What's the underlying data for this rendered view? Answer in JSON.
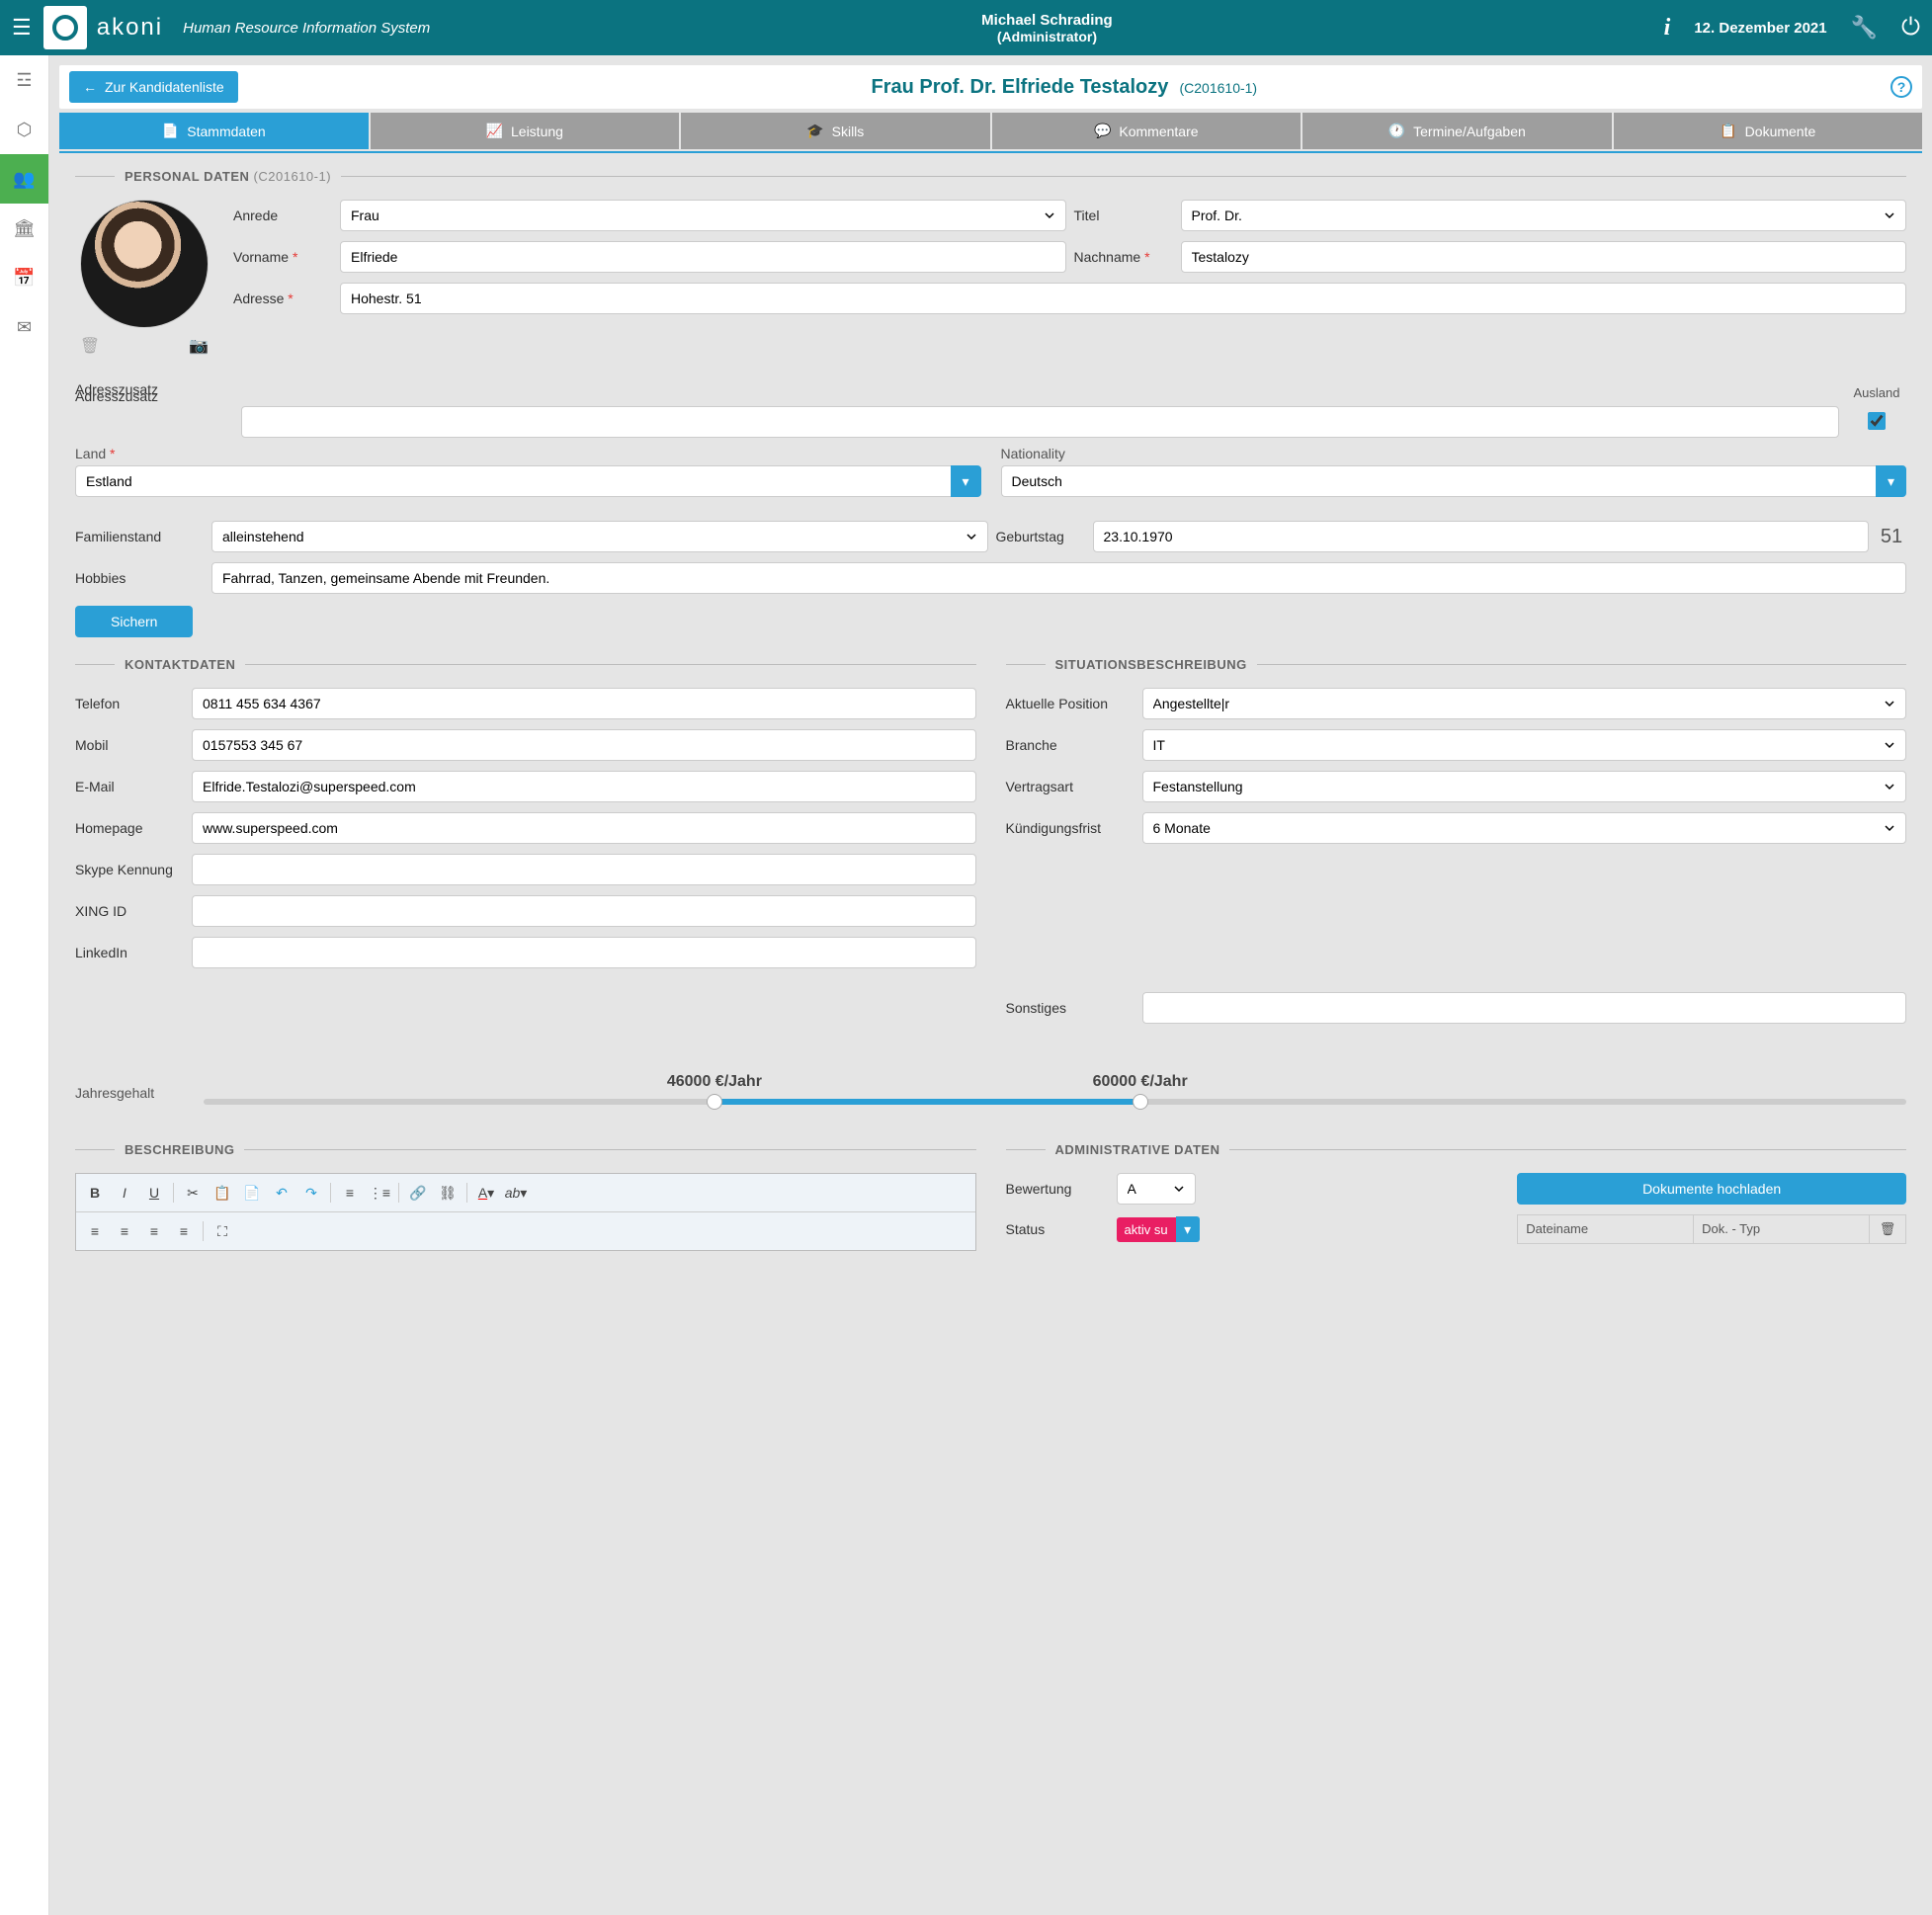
{
  "header": {
    "brand": "akoni",
    "tagline": "Human Resource Information System",
    "user": "Michael Schrading",
    "role": "(Administrator)",
    "date": "12. Dezember 2021"
  },
  "page": {
    "back": "Zur Kandidatenliste",
    "title": "Frau Prof. Dr. Elfriede Testalozy",
    "pid": "(C201610-1)"
  },
  "tabs": [
    "Stammdaten",
    "Leistung",
    "Skills",
    "Kommentare",
    "Termine/Aufgaben",
    "Dokumente"
  ],
  "sections": {
    "personal": {
      "title": "PERSONAL DATEN",
      "sub": "(C201610-1)"
    },
    "contact": "KONTAKTDATEN",
    "situation": "SITUATIONSBESCHREIBUNG",
    "description": "BESCHREIBUNG",
    "admin": "ADMINISTRATIVE DATEN"
  },
  "labels": {
    "anrede": "Anrede",
    "titel": "Titel",
    "vorname": "Vorname",
    "nachname": "Nachname",
    "adresse": "Adresse",
    "adresszusatz": "Adresszusatz",
    "ausland": "Ausland",
    "land": "Land",
    "nationality": "Nationality",
    "familienstand": "Familienstand",
    "geburtstag": "Geburtstag",
    "hobbies": "Hobbies",
    "sichern": "Sichern",
    "telefon": "Telefon",
    "mobil": "Mobil",
    "email": "E-Mail",
    "homepage": "Homepage",
    "skype": "Skype Kennung",
    "xing": "XING ID",
    "linkedin": "LinkedIn",
    "sonstiges": "Sonstiges",
    "position": "Aktuelle Position",
    "branche": "Branche",
    "vertragsart": "Vertragsart",
    "kuendigung": "Kündigungsfrist",
    "jahresgehalt": "Jahresgehalt",
    "bewertung": "Bewertung",
    "status": "Status",
    "upload": "Dokumente hochladen",
    "dateiname": "Dateiname",
    "doktyp": "Dok. - Typ"
  },
  "values": {
    "anrede": "Frau",
    "titel": "Prof. Dr.",
    "vorname": "Elfriede",
    "nachname": "Testalozy",
    "adresse": "Hohestr. 51",
    "adresszusatz": "",
    "ausland": true,
    "land": "Estland",
    "nationality": "Deutsch",
    "familienstand": "alleinstehend",
    "geburtstag": "23.10.1970",
    "age": "51",
    "hobbies": "Fahrrad, Tanzen, gemeinsame Abende mit Freunden.",
    "telefon": "0811 455 634 4367",
    "mobil": "0157553 345 67",
    "email": "Elfride.Testalozi@superspeed.com",
    "homepage": "www.superspeed.com",
    "skype": "",
    "xing": "",
    "linkedin": "",
    "sonstiges": "",
    "position": "Angestellte|r",
    "branche": "IT",
    "vertragsart": "Festanstellung",
    "kuendigung": "6 Monate",
    "salary_low": "46000 €/Jahr",
    "salary_high": "60000 €/Jahr",
    "bewertung": "A",
    "status": "aktiv su"
  }
}
